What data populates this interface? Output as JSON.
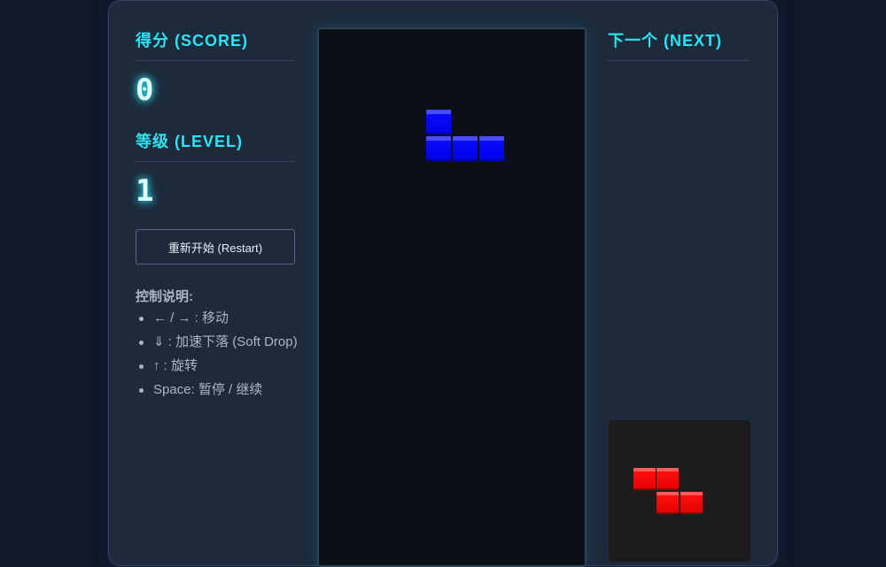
{
  "score": {
    "label": "得分 (SCORE)",
    "value": "0"
  },
  "level": {
    "label": "等级 (LEVEL)",
    "value": "1"
  },
  "restart_label": "重新开始 (Restart)",
  "controls": {
    "title": "控制说明:",
    "items": [
      "← / → : 移动",
      "⇓ : 加速下落 (Soft Drop)",
      "↑ : 旋转",
      "Space: 暂停 / 继续"
    ]
  },
  "next": {
    "label": "下一个 (NEXT)",
    "piece": "Z",
    "color": "#ff1010"
  },
  "current_piece": {
    "piece": "J",
    "color": "#0000ff"
  },
  "colors": {
    "accent": "#29e6f2",
    "panel": "#1d2a3b",
    "board": "#0b0f17"
  }
}
